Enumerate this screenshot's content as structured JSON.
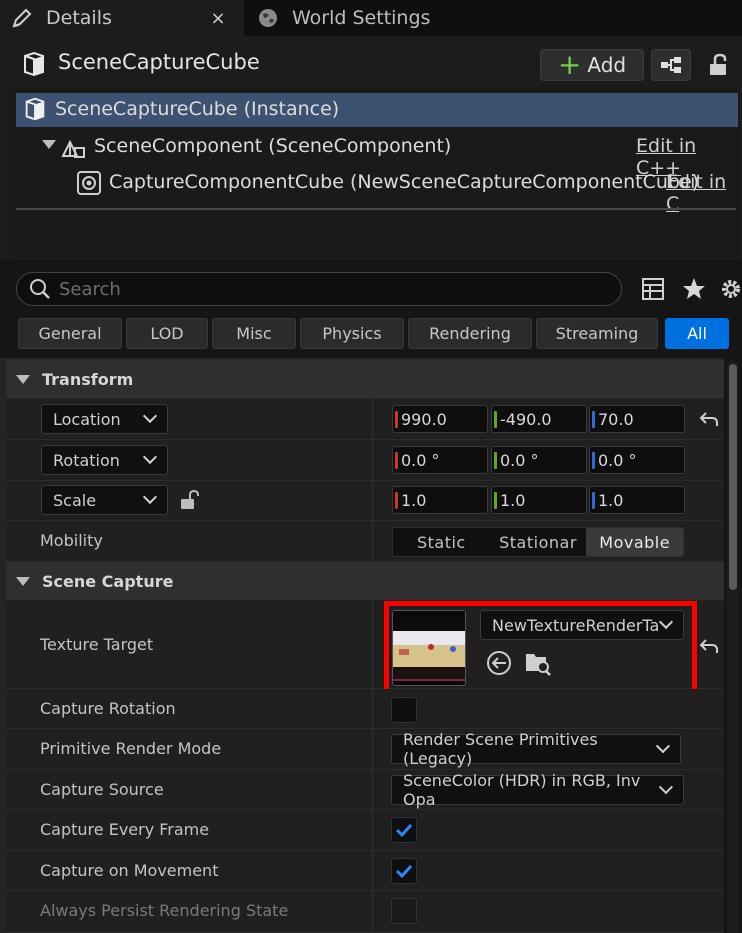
{
  "tabs": [
    {
      "label": "Details",
      "icon": "pencil-icon"
    },
    {
      "label": "World Settings",
      "icon": "globe-icon"
    }
  ],
  "close_glyph": "×",
  "header": {
    "title": "SceneCaptureCube",
    "add_label": "Add"
  },
  "tree": [
    {
      "label": "SceneCaptureCube (Instance)",
      "selected": true
    },
    {
      "label": "SceneComponent (SceneComponent)",
      "link": "Edit in C++"
    },
    {
      "label": "CaptureComponentCube (NewSceneCaptureComponentCube)",
      "link": "Edit in C"
    }
  ],
  "search": {
    "placeholder": "Search"
  },
  "filters": [
    "General",
    "LOD",
    "Misc",
    "Physics",
    "Rendering",
    "Streaming",
    "All"
  ],
  "active_filter": "All",
  "transform": {
    "title": "Transform",
    "location": {
      "label": "Location",
      "x": "990.0",
      "y": "-490.0",
      "z": "70.0"
    },
    "rotation": {
      "label": "Rotation",
      "x": "0.0 °",
      "y": "0.0 °",
      "z": "0.0 °"
    },
    "scale": {
      "label": "Scale",
      "x": "1.0",
      "y": "1.0",
      "z": "1.0"
    },
    "mobility": {
      "label": "Mobility",
      "options": [
        "Static",
        "Stationar",
        "Movable"
      ],
      "selected": "Movable"
    }
  },
  "scene_capture": {
    "title": "Scene Capture",
    "texture_target": {
      "label": "Texture Target",
      "value": "NewTextureRenderTa"
    },
    "capture_rotation": {
      "label": "Capture Rotation",
      "checked": false
    },
    "primitive_render_mode": {
      "label": "Primitive Render Mode",
      "value": "Render Scene Primitives (Legacy)"
    },
    "capture_source": {
      "label": "Capture Source",
      "value": "SceneColor (HDR) in RGB, Inv Opa"
    },
    "capture_every_frame": {
      "label": "Capture Every Frame",
      "checked": true
    },
    "capture_on_movement": {
      "label": "Capture on Movement",
      "checked": true
    },
    "always_persist": {
      "label": "Always Persist Rendering State",
      "checked": false
    }
  },
  "colors": {
    "accent": "#0070e0",
    "selection": "#3d5170",
    "highlight": "#ff0000",
    "add_plus": "#6fd14a"
  }
}
